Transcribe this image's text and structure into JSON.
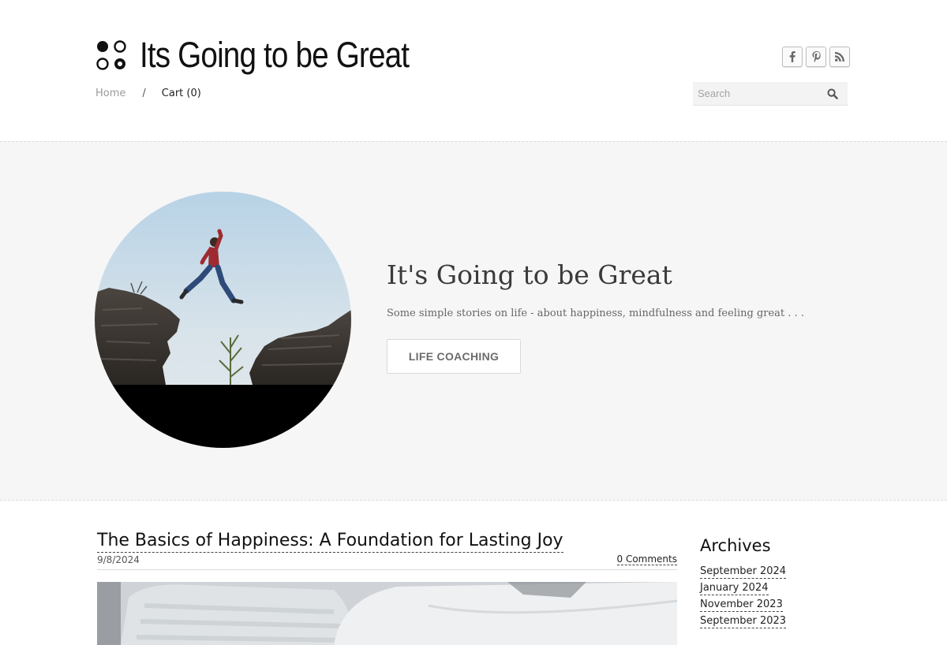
{
  "header": {
    "site_title": "Its Going to be Great",
    "nav": {
      "home": "Home",
      "separator": "/",
      "cart": "Cart (0)"
    },
    "search": {
      "placeholder": "Search"
    },
    "social": [
      "facebook-icon",
      "pinterest-icon",
      "rss-icon"
    ]
  },
  "hero": {
    "title": "It's Going to be Great",
    "subtitle": "Some simple stories on life - about happiness, mindfulness and feeling great . . .",
    "button_label": "LIFE COACHING"
  },
  "post": {
    "title": "The Basics of Happiness: A Foundation for Lasting Joy",
    "date": "9/8/2024",
    "comments": "0 Comments"
  },
  "sidebar": {
    "archives_title": "Archives",
    "archives": [
      "September 2024",
      "January 2024",
      "November 2023",
      "September 2023"
    ]
  },
  "colors": {
    "hero_background": "#f6f6f6",
    "page_background": "#ffffff",
    "text": "#222222"
  }
}
